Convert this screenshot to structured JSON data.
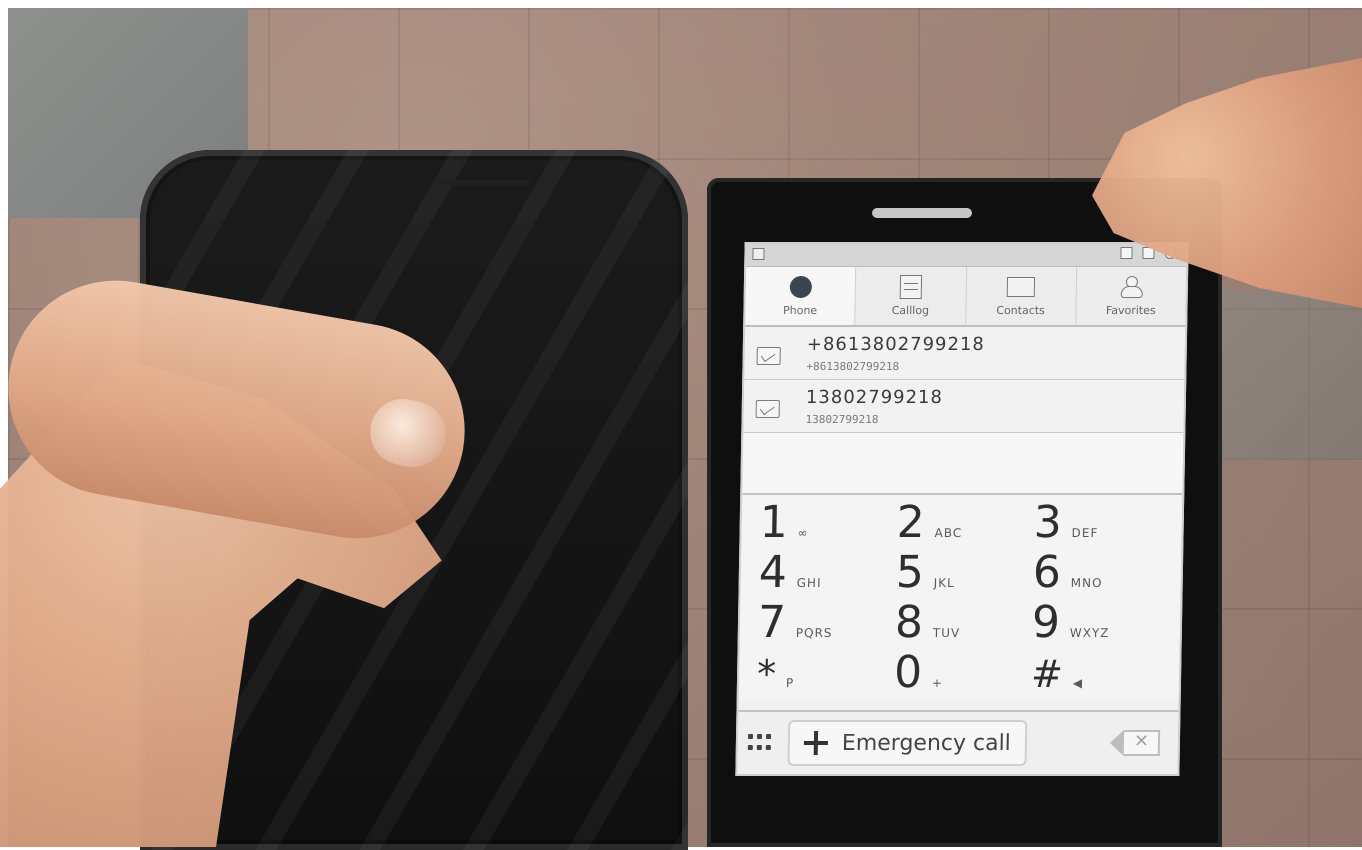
{
  "right_phone": {
    "tabs": [
      {
        "label": "Phone"
      },
      {
        "label": "Calllog"
      },
      {
        "label": "Contacts"
      },
      {
        "label": "Favorites"
      }
    ],
    "entries": [
      {
        "number": "+8613802799218",
        "subtext": "+8613802799218"
      },
      {
        "number": "13802799218",
        "subtext": "13802799218"
      }
    ],
    "keypad": [
      [
        {
          "digit": "1",
          "letters": "∞"
        },
        {
          "digit": "2",
          "letters": "ABC"
        },
        {
          "digit": "3",
          "letters": "DEF"
        }
      ],
      [
        {
          "digit": "4",
          "letters": "GHI"
        },
        {
          "digit": "5",
          "letters": "JKL"
        },
        {
          "digit": "6",
          "letters": "MNO"
        }
      ],
      [
        {
          "digit": "7",
          "letters": "PQRS"
        },
        {
          "digit": "8",
          "letters": "TUV"
        },
        {
          "digit": "9",
          "letters": "WXYZ"
        }
      ],
      [
        {
          "digit": "*",
          "letters": "P"
        },
        {
          "digit": "0",
          "letters": "+"
        },
        {
          "digit": "#",
          "letters": "◀"
        }
      ]
    ],
    "emergency_label": "Emergency call"
  }
}
